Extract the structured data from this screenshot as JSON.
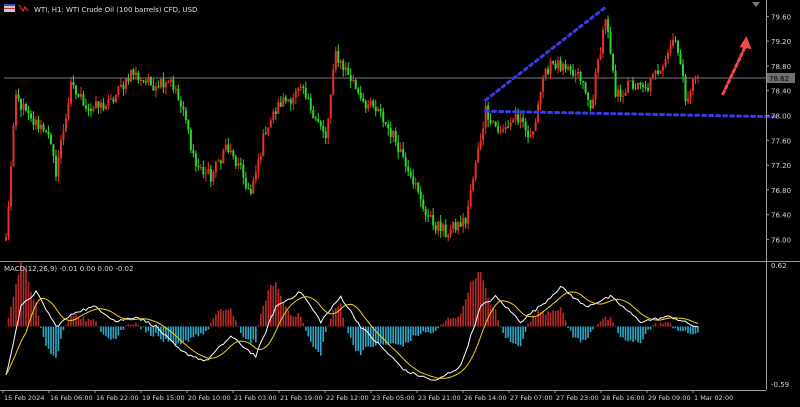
{
  "header": {
    "symbol_label": "WTI, H1:  WTI Crude Oil (100 barrels) CFD, USD"
  },
  "price_axis": {
    "labels": [
      "79.60",
      "79.20",
      "78.80",
      "78.40",
      "78.00",
      "77.60",
      "77.20",
      "76.80",
      "76.40",
      "76.00"
    ],
    "current_price": "78.62"
  },
  "macd": {
    "label": "MACD(12,26,9) -0.01 0.00 0.00 -0.02",
    "scale_top": "0.62",
    "scale_bottom": "-0.59"
  },
  "time_axis": {
    "labels": [
      "15 Feb 2024",
      "16 Feb 06:00",
      "16 Feb 22:00",
      "19 Feb 15:00",
      "20 Feb 10:00",
      "21 Feb 03:00",
      "21 Feb 19:00",
      "22 Feb 12:00",
      "23 Feb 05:00",
      "23 Feb 21:00",
      "26 Feb 14:00",
      "27 Feb 07:00",
      "27 Feb 23:00",
      "28 Feb 16:00",
      "29 Feb 09:00",
      "1 Mar 02:00"
    ]
  },
  "colors": {
    "background": "#000000",
    "bull": "#e8302a",
    "bear": "#2fd52f",
    "macd_pos": "#b8282a",
    "macd_neg": "#2fa8c8",
    "signal": "#f0d020",
    "macd_line": "#ffffff",
    "annotation_line": "#3a3ae8",
    "forecast_arrow": "#f04a4a",
    "price_line": "#7a7a7a"
  },
  "chart_data": {
    "type": "candlestick",
    "title": "WTI, H1:  WTI Crude Oil (100 barrels) CFD, USD",
    "price_range": [
      75.7,
      79.8
    ],
    "current_price": 78.62,
    "anchors": [
      [
        0,
        76.0
      ],
      [
        4,
        78.3
      ],
      [
        10,
        77.9
      ],
      [
        16,
        77.8
      ],
      [
        20,
        77.1
      ],
      [
        26,
        78.45
      ],
      [
        34,
        78.1
      ],
      [
        42,
        78.2
      ],
      [
        50,
        78.7
      ],
      [
        58,
        78.5
      ],
      [
        66,
        78.6
      ],
      [
        72,
        77.9
      ],
      [
        76,
        77.2
      ],
      [
        82,
        77.0
      ],
      [
        88,
        77.5
      ],
      [
        94,
        77.1
      ],
      [
        98,
        76.7
      ],
      [
        104,
        77.8
      ],
      [
        110,
        78.2
      ],
      [
        118,
        78.4
      ],
      [
        124,
        78.0
      ],
      [
        128,
        77.6
      ],
      [
        132,
        79.0
      ],
      [
        138,
        78.6
      ],
      [
        144,
        78.2
      ],
      [
        150,
        78.0
      ],
      [
        156,
        77.6
      ],
      [
        162,
        77.1
      ],
      [
        166,
        76.6
      ],
      [
        170,
        76.3
      ],
      [
        176,
        76.1
      ],
      [
        184,
        76.3
      ],
      [
        188,
        77.2
      ],
      [
        192,
        78.1
      ],
      [
        198,
        77.7
      ],
      [
        204,
        78.0
      ],
      [
        210,
        77.6
      ],
      [
        214,
        78.4
      ],
      [
        218,
        78.9
      ],
      [
        224,
        78.7
      ],
      [
        230,
        78.6
      ],
      [
        234,
        78.1
      ],
      [
        240,
        79.6
      ],
      [
        244,
        78.3
      ],
      [
        250,
        78.5
      ],
      [
        256,
        78.4
      ],
      [
        262,
        78.8
      ],
      [
        268,
        79.3
      ],
      [
        272,
        78.3
      ],
      [
        276,
        78.6
      ]
    ],
    "trendlines": [
      {
        "from": [
          192,
          78.25
        ],
        "to": [
          240,
          79.75
        ]
      },
      {
        "from": [
          192,
          78.07
        ],
        "to": [
          308,
          77.98
        ]
      }
    ],
    "forecast_arrow": {
      "from": [
        287,
        78.35
      ],
      "to": [
        296,
        79.25
      ]
    },
    "macd_range": [
      -0.59,
      0.62
    ],
    "macd_line_anchors": [
      [
        0,
        -0.5
      ],
      [
        6,
        0.2
      ],
      [
        12,
        0.35
      ],
      [
        20,
        0.0
      ],
      [
        28,
        0.15
      ],
      [
        36,
        0.2
      ],
      [
        44,
        0.05
      ],
      [
        52,
        0.1
      ],
      [
        60,
        0.0
      ],
      [
        70,
        -0.25
      ],
      [
        80,
        -0.35
      ],
      [
        90,
        -0.1
      ],
      [
        100,
        -0.3
      ],
      [
        108,
        0.2
      ],
      [
        118,
        0.35
      ],
      [
        126,
        0.05
      ],
      [
        134,
        0.3
      ],
      [
        142,
        0.0
      ],
      [
        150,
        -0.2
      ],
      [
        160,
        -0.45
      ],
      [
        172,
        -0.55
      ],
      [
        182,
        -0.4
      ],
      [
        190,
        0.2
      ],
      [
        196,
        0.3
      ],
      [
        206,
        0.05
      ],
      [
        216,
        0.25
      ],
      [
        222,
        0.4
      ],
      [
        232,
        0.2
      ],
      [
        242,
        0.3
      ],
      [
        254,
        0.05
      ],
      [
        266,
        0.1
      ],
      [
        276,
        0.0
      ]
    ]
  }
}
